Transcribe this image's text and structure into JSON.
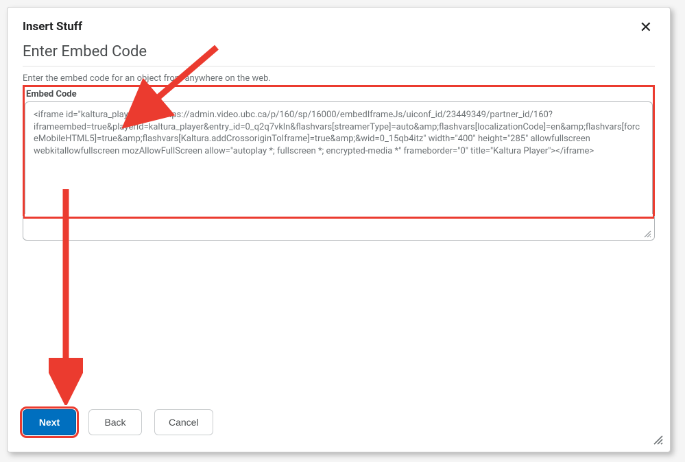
{
  "dialog": {
    "title": "Insert Stuff",
    "subtitle": "Enter Embed Code",
    "help_text": "Enter the embed code for an object from anywhere on the web.",
    "field_label": "Embed Code",
    "embed_value": "<iframe id=\"kaltura_player\" src=\"https://admin.video.ubc.ca/p/160/sp/16000/embedIframeJs/uiconf_id/23449349/partner_id/160?iframeembed=true&playerId=kaltura_player&entry_id=0_q2q7vkln&flashvars[streamerType]=auto&amp;flashvars[localizationCode]=en&amp;flashvars[forceMobileHTML5]=true&amp;flashvars[Kaltura.addCrossoriginToIframe]=true&amp;&wid=0_15qb4itz\" width=\"400\" height=\"285\" allowfullscreen webkitallowfullscreen mozAllowFullScreen allow=\"autoplay *; fullscreen *; encrypted-media *\" frameborder=\"0\" title=\"Kaltura Player\"></iframe>"
  },
  "buttons": {
    "next": "Next",
    "back": "Back",
    "cancel": "Cancel",
    "close": "✕"
  },
  "annotations": {
    "highlight_color": "#eb3b2f"
  }
}
